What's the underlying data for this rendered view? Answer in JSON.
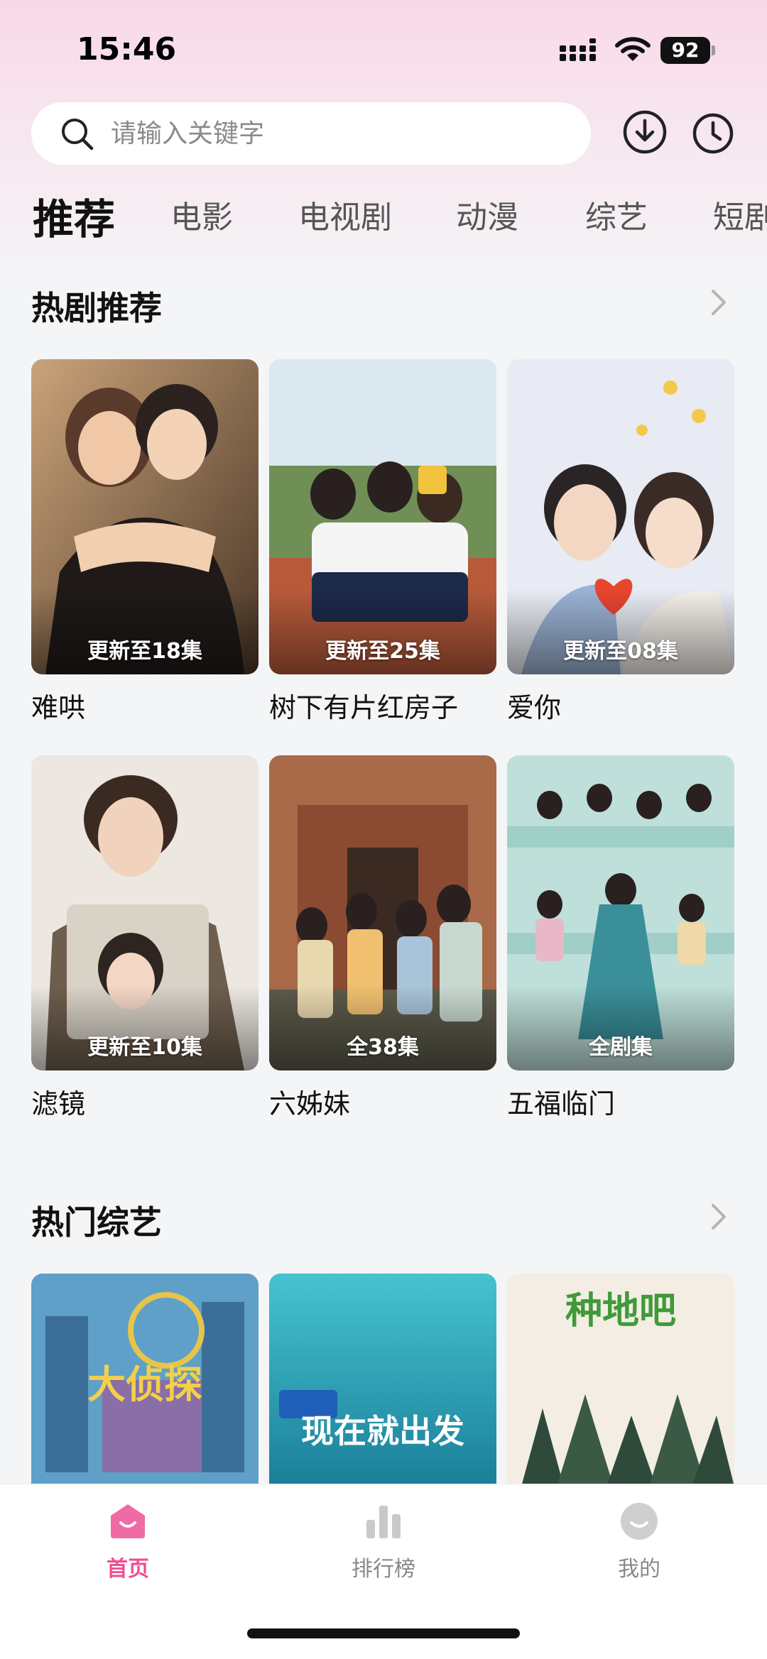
{
  "status_bar": {
    "time": "15:46",
    "battery": "92"
  },
  "search": {
    "placeholder": "请输入关键字"
  },
  "header_icons": [
    "download-icon",
    "history-icon"
  ],
  "tabs": [
    {
      "label": "推荐",
      "active": true
    },
    {
      "label": "电影"
    },
    {
      "label": "电视剧"
    },
    {
      "label": "动漫"
    },
    {
      "label": "综艺"
    },
    {
      "label": "短剧"
    }
  ],
  "hot_dramas": {
    "title": "热剧推荐",
    "items": [
      {
        "title": "难哄",
        "badge": "更新至18集"
      },
      {
        "title": "树下有片红房子",
        "badge": "更新至25集"
      },
      {
        "title": "爱你",
        "badge": "更新至08集"
      },
      {
        "title": "滤镜",
        "badge": "更新至10集"
      },
      {
        "title": "六姊妹",
        "badge": "全38集"
      },
      {
        "title": "五福临门",
        "badge": "全剧集"
      }
    ]
  },
  "hot_variety": {
    "title": "热门综艺",
    "items": [
      {
        "poster_text": "大侦探"
      },
      {
        "poster_text": "现在就出发"
      },
      {
        "poster_text": "种地吧"
      }
    ]
  },
  "bottom_nav": [
    {
      "label": "首页",
      "active": true
    },
    {
      "label": "排行榜"
    },
    {
      "label": "我的"
    }
  ],
  "colors": {
    "accent": "#ee4f92",
    "background": "#f4f5f7"
  }
}
